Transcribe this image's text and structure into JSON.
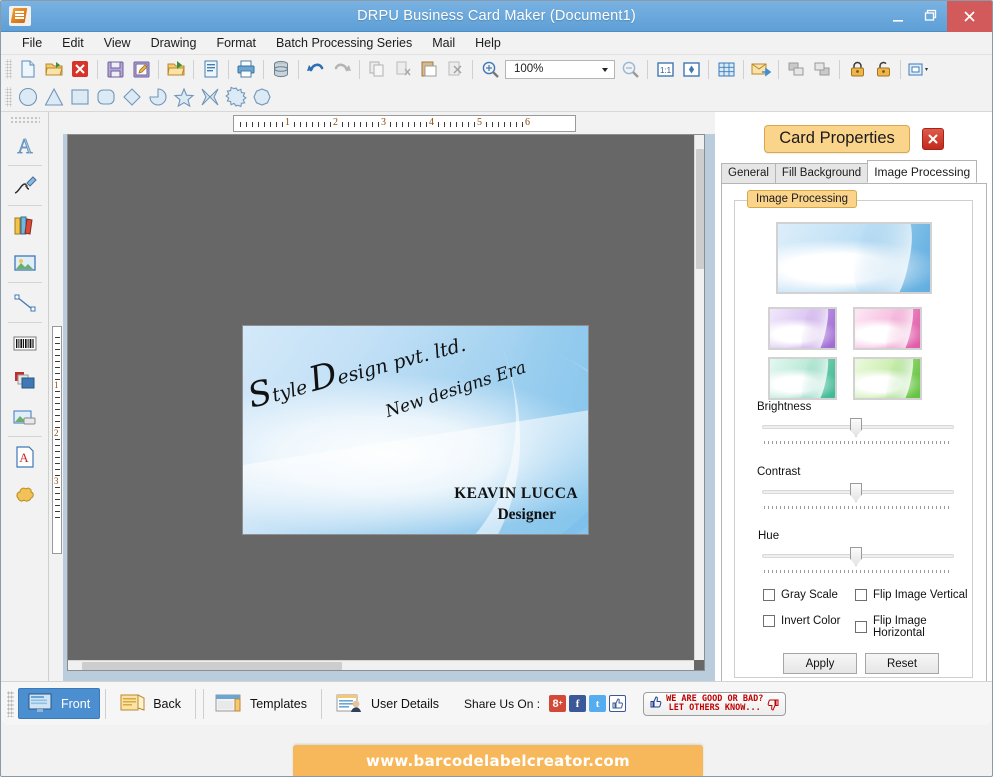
{
  "window": {
    "title": "DRPU Business Card Maker (Document1)",
    "icon": "app-icon",
    "minimize": "–",
    "restore": "❐",
    "close": "✕"
  },
  "menubar": {
    "items": [
      {
        "label": "File",
        "accel": "F"
      },
      {
        "label": "Edit",
        "accel": "E"
      },
      {
        "label": "View",
        "accel": "V"
      },
      {
        "label": "Drawing",
        "accel": "D"
      },
      {
        "label": "Format",
        "accel": "F"
      },
      {
        "label": "Batch Processing Series",
        "accel": "B"
      },
      {
        "label": "Mail",
        "accel": "M"
      },
      {
        "label": "Help",
        "accel": "H"
      }
    ]
  },
  "toolbar": {
    "zoom_value": "100%",
    "buttons": [
      {
        "name": "new-document",
        "tip": "New"
      },
      {
        "name": "open-document",
        "tip": "Open"
      },
      {
        "name": "close-document",
        "tip": "Close"
      },
      {
        "name": "save-document",
        "tip": "Save"
      },
      {
        "name": "save-as-document",
        "tip": "Save As"
      },
      {
        "name": "export-folder",
        "tip": "Export"
      },
      {
        "name": "print-preview",
        "tip": "Print Preview"
      },
      {
        "name": "print",
        "tip": "Print"
      },
      {
        "name": "database",
        "tip": "Database"
      },
      {
        "name": "undo",
        "tip": "Undo"
      },
      {
        "name": "redo",
        "tip": "Redo"
      },
      {
        "name": "copy",
        "tip": "Copy"
      },
      {
        "name": "cut",
        "tip": "Cut"
      },
      {
        "name": "paste",
        "tip": "Paste"
      },
      {
        "name": "delete",
        "tip": "Delete"
      },
      {
        "name": "zoom-in",
        "tip": "Zoom In"
      },
      {
        "name": "zoom-out",
        "tip": "Zoom Out"
      },
      {
        "name": "actual-size",
        "tip": "1:1"
      },
      {
        "name": "fit-page",
        "tip": "Fit Page"
      },
      {
        "name": "grid",
        "tip": "Grid"
      },
      {
        "name": "send-mail",
        "tip": "Send Mail"
      },
      {
        "name": "bring-front",
        "tip": "Bring To Front"
      },
      {
        "name": "send-back",
        "tip": "Send To Back"
      },
      {
        "name": "lock",
        "tip": "Lock"
      },
      {
        "name": "unlock",
        "tip": "Unlock"
      },
      {
        "name": "align",
        "tip": "Align"
      }
    ],
    "shapes": [
      {
        "name": "ellipse-shape"
      },
      {
        "name": "triangle-shape"
      },
      {
        "name": "rectangle-shape"
      },
      {
        "name": "rounded-rectangle-shape"
      },
      {
        "name": "diamond-shape"
      },
      {
        "name": "pie-shape"
      },
      {
        "name": "star-shape"
      },
      {
        "name": "four-point-star-shape"
      },
      {
        "name": "burst-shape"
      },
      {
        "name": "polygon-shape"
      }
    ]
  },
  "left_tools": [
    {
      "name": "text-tool",
      "tip": "Text"
    },
    {
      "name": "signature-tool",
      "tip": "Signature"
    },
    {
      "name": "library-tool",
      "tip": "Library"
    },
    {
      "name": "picture-tool",
      "tip": "Picture"
    },
    {
      "name": "line-tool",
      "tip": "Line"
    },
    {
      "name": "barcode-tool",
      "tip": "Barcode"
    },
    {
      "name": "shapes-tool",
      "tip": "Shapes"
    },
    {
      "name": "image-tool",
      "tip": "Image"
    },
    {
      "name": "watermark-text-tool",
      "tip": "Watermark Text"
    },
    {
      "name": "watermark-image-tool",
      "tip": "Watermark Image"
    }
  ],
  "rulers": {
    "horizontal_labels": [
      "1",
      "2",
      "3",
      "4",
      "5",
      "6"
    ],
    "vertical_labels": [
      "1",
      "2",
      "3"
    ],
    "units": "inches"
  },
  "card": {
    "title_s": "S",
    "title_tyle": "tyle",
    "title_d": "D",
    "title_rest": "esign pvt. ltd.",
    "subtitle": "New designs Era",
    "name": "KEAVIN LUCCA",
    "role": "Designer"
  },
  "properties": {
    "heading": "Card Properties",
    "close_label": "✕",
    "tabs": [
      {
        "label": "General",
        "active": false
      },
      {
        "label": "Fill Background",
        "active": false
      },
      {
        "label": "Image Processing",
        "active": true
      }
    ],
    "group_label": "Image Processing",
    "thumbnails": [
      {
        "name": "thumbnail-blue-selected",
        "color": "#5aa8dd",
        "selected": true
      },
      {
        "name": "thumbnail-purple",
        "color": "#a06ad4"
      },
      {
        "name": "thumbnail-pink",
        "color": "#e05aa8"
      },
      {
        "name": "thumbnail-teal",
        "color": "#3fb995"
      },
      {
        "name": "thumbnail-green",
        "color": "#63c23f"
      }
    ],
    "sliders": [
      {
        "label": "Brightness",
        "value": 50
      },
      {
        "label": "Contrast",
        "value": 50
      },
      {
        "label": "Hue",
        "value": 50
      }
    ],
    "checkboxes": [
      {
        "label": "Gray Scale",
        "checked": false
      },
      {
        "label": "Flip Image Vertical",
        "checked": false
      },
      {
        "label": "Invert Color",
        "checked": false
      },
      {
        "label": "Flip Image Horizontal",
        "checked": false
      }
    ],
    "apply_label": "Apply",
    "reset_label": "Reset"
  },
  "bottombar": {
    "front_label": "Front",
    "back_label": "Back",
    "templates_label": "Templates",
    "user_details_label": "User Details",
    "share_label": "Share Us On :",
    "social": [
      {
        "name": "google-plus-icon",
        "glyph": "g"
      },
      {
        "name": "facebook-icon",
        "glyph": "f"
      },
      {
        "name": "twitter-icon",
        "glyph": "t"
      },
      {
        "name": "like-icon",
        "glyph": "ὄD"
      }
    ],
    "feedback_line1": "WE ARE GOOD OR BAD?",
    "feedback_line2": "LET OTHERS KNOW...",
    "watermark": "www.barcodelabelcreator.com"
  },
  "colors": {
    "titlebar": "#6aa9dd",
    "accent_badge": "#fbd48c",
    "canvas": "#676767",
    "selection": "#4c8fd0",
    "watermark": "#f7b85c"
  }
}
